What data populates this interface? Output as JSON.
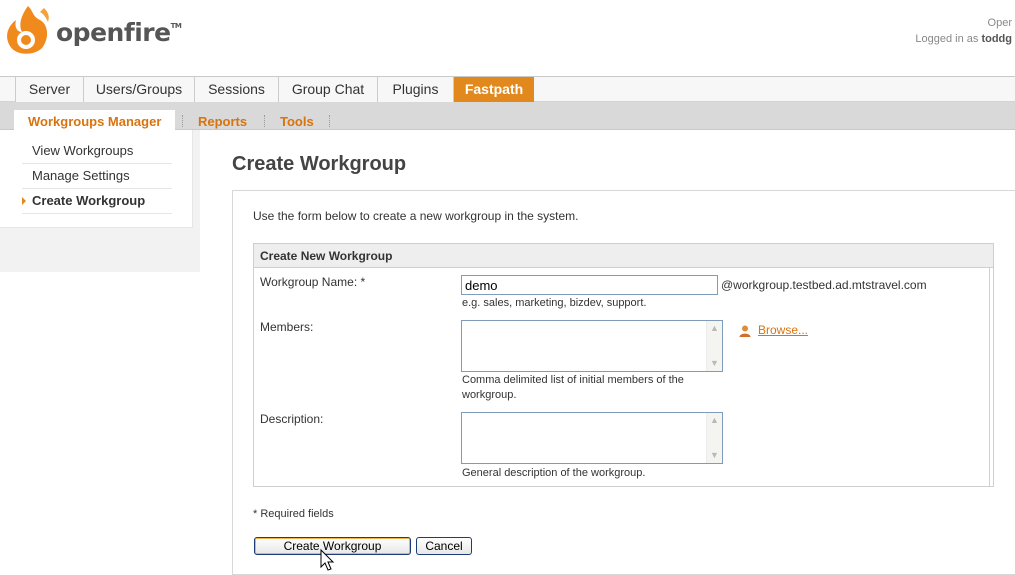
{
  "header": {
    "logo_text": "openfire",
    "logo_tm": "TM",
    "version_text": "Oper",
    "logged_in_prefix": "Logged in as",
    "username": "toddg"
  },
  "main_tabs": [
    {
      "label": "Server"
    },
    {
      "label": "Users/Groups"
    },
    {
      "label": "Sessions"
    },
    {
      "label": "Group Chat"
    },
    {
      "label": "Plugins"
    },
    {
      "label": "Fastpath",
      "active": true
    }
  ],
  "sub_tabs": [
    {
      "label": "Workgroups Manager",
      "active": true
    },
    {
      "label": "Reports"
    },
    {
      "label": "Tools"
    }
  ],
  "sidebar": {
    "items": [
      {
        "label": "View Workgroups"
      },
      {
        "label": "Manage Settings"
      },
      {
        "label": "Create Workgroup",
        "active": true
      }
    ]
  },
  "page": {
    "title": "Create Workgroup",
    "intro": "Use the form below to create a new workgroup in the system."
  },
  "form": {
    "section_title": "Create New Workgroup",
    "name_label": "Workgroup Name: *",
    "name_value": "demo",
    "domain_suffix": "@workgroup.testbed.ad.mtstravel.com",
    "name_hint": "e.g. sales, marketing, bizdev, support.",
    "members_label": "Members:",
    "members_value": "",
    "members_hint_line1": "Comma delimited list of initial members of the",
    "members_hint_line2": "workgroup.",
    "browse_label": "Browse...",
    "description_label": "Description:",
    "description_value": "",
    "description_hint": "General description of the workgroup.",
    "required_note": "* Required fields",
    "create_button": "Create Workgroup",
    "cancel_button": "Cancel"
  },
  "colors": {
    "accent": "#e2891d",
    "link": "#d9730d"
  }
}
